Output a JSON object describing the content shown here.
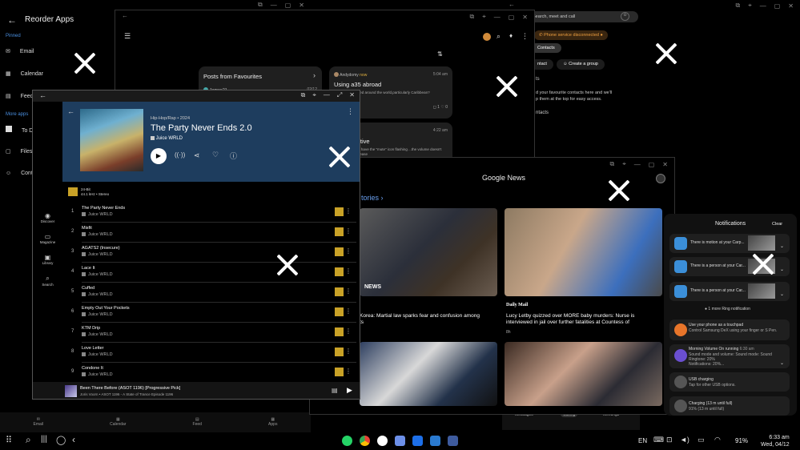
{
  "reorder": {
    "title": "Reorder Apps",
    "pinned": "Pinned",
    "items": [
      "Email",
      "Calendar",
      "Feed"
    ],
    "more": "More apps",
    "more_items": [
      "To D",
      "Files",
      "Cont"
    ]
  },
  "bottom_tabs": [
    "Email",
    "Calendar",
    "Feed",
    "Apps"
  ],
  "community": {
    "posts_header": "Posts from Favourites",
    "user1": "James21",
    "user1_date": "02/12",
    "user2": "Andydomy",
    "user2_badge": "now",
    "user2_time": "5:04 am",
    "post_title": "Using a35 abroad",
    "post_text": "A35,can it be used around the world,particularly Caribbean?",
    "likes_a": "1",
    "likes_b": "0",
    "time2": "4:22 am",
    "post2_title": "always active",
    "post2_text": "6120 TV Smart I have the \"mute\" icon flashing ...the volume doesn't increase or decrease"
  },
  "contacts": {
    "search": "Search, meet and call",
    "warning": "Phone service disconnected",
    "tab": "Contacts",
    "contact_btn": "ntact",
    "group_btn": "Create a group",
    "section1": "ts",
    "fav_text": "d your favourite contacts here and we'll",
    "fav_text2": "p them at the top for easy access.",
    "section2": "ntacts",
    "nav": [
      "Messages",
      "Calling",
      "Meetings"
    ]
  },
  "news": {
    "title": "Google News",
    "stories": "tories",
    "card1_source": "NEWS",
    "card1_title": "Korea: Martial law sparks fear and confusion among",
    "card1_title2": "ts",
    "card2_source": "Daily Mail",
    "card2_title": "Lucy Letby quizzed over MORE baby murders: Nurse is",
    "card2_title2": "interviewed in jail over further fatalities at Countess of",
    "card2_time": "8h"
  },
  "music": {
    "genre": "Hip-Hop/Rap • 2024",
    "album": "The Party Never Ends 2.0",
    "artist": "Juice WRLD",
    "quality1": "24-Bit",
    "quality2": "44.1 kHz • Stereo",
    "nav": [
      "Discover",
      "Magazine",
      "Library",
      "Search"
    ],
    "tracks": [
      {
        "n": "1",
        "t": "The Party Never Ends",
        "a": "Juice WRLD"
      },
      {
        "n": "2",
        "t": "Misfit",
        "a": "Juice WRLD"
      },
      {
        "n": "3",
        "t": "AGATS2 (Insecure)",
        "a": "Juice WRLD"
      },
      {
        "n": "4",
        "t": "Lace It",
        "a": "Juice WRLD"
      },
      {
        "n": "5",
        "t": "Cuffed",
        "a": "Juice WRLD"
      },
      {
        "n": "6",
        "t": "Empty Out Your Pockets",
        "a": "Juice WRLD"
      },
      {
        "n": "7",
        "t": "KTM Drip",
        "a": "Juice WRLD"
      },
      {
        "n": "8",
        "t": "Love Letter",
        "a": "Juice WRLD"
      },
      {
        "n": "9",
        "t": "Condone It",
        "a": "Juice WRLD"
      }
    ],
    "now_title": "Been There Before (ASOT 1196) [Progressive Pick]",
    "now_sub": "Joris Voorn • ASOT 1196 - A State of Trance Episode 1196"
  },
  "notifications": {
    "title": "Notifications",
    "clear": "Clear",
    "ring1": "There is motion at your Carp...",
    "ring2": "There is a person at your Car...",
    "ring3": "There is a person at your Car...",
    "more": "1 more Ring notification",
    "dex1": "Use your phone as a touchpad",
    "dex2": "Control Samsung DeX using your finger or S Pen.",
    "vol1": "Morning Volume On running",
    "vol_time": "6:30 am",
    "vol2": "Sound mode and volume: Sound mode: Sound",
    "vol3": "Ringtone: 20%",
    "vol4": "Notifications: 20%...",
    "usb1": "USB charging",
    "usb2": "Tap for other USB options.",
    "chg1": "Charging (13 m until full)",
    "chg2": "91% (13 m until full)"
  },
  "taskbar": {
    "lang": "EN",
    "battery": "91%",
    "time": "6:33 am",
    "date": "Wed, 04/12"
  },
  "colors": {
    "music_header": "#1e3d5e",
    "accent": "#3a7bd5",
    "quality": "#c9a227"
  }
}
